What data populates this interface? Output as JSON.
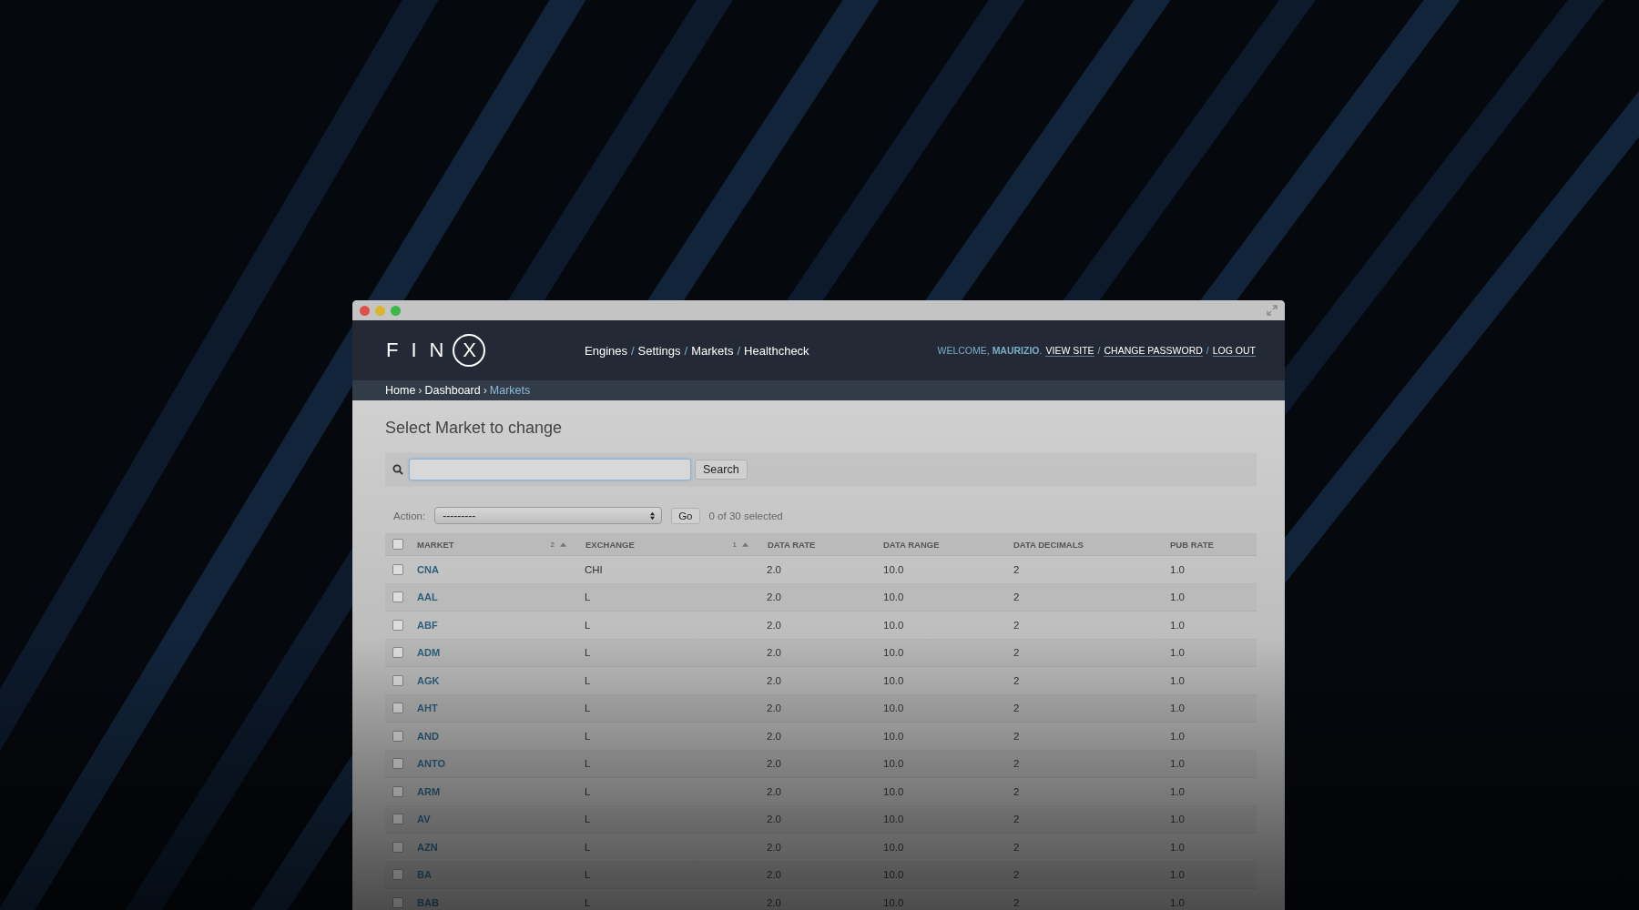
{
  "window": {
    "controls": [
      {
        "color": "#e0504a"
      },
      {
        "color": "#d9b530"
      },
      {
        "color": "#3cb84a"
      }
    ]
  },
  "logo": {
    "letters": [
      "F",
      "I",
      "N"
    ],
    "circled": "X"
  },
  "nav": {
    "links": [
      "Engines",
      "Settings",
      "Markets",
      "Healthcheck"
    ],
    "separator": "/"
  },
  "user_tools": {
    "welcome": "WELCOME,",
    "user": "MAURIZIO",
    "user_suffix": ".",
    "links": [
      "VIEW SITE",
      "CHANGE PASSWORD",
      "LOG OUT"
    ],
    "separator": "/"
  },
  "breadcrumbs": {
    "items": [
      {
        "label": "Home",
        "current": false
      },
      {
        "label": "Dashboard",
        "current": false
      },
      {
        "label": "Markets",
        "current": true
      }
    ],
    "separator": "›"
  },
  "heading": "Select Market to change",
  "search": {
    "button": "Search"
  },
  "actions": {
    "label": "Action:",
    "value": "---------",
    "go": "Go",
    "counter": "0 of 30 selected"
  },
  "table": {
    "columns": [
      {
        "label": "MARKET",
        "sort_priority": "2",
        "select_all_checked": false
      },
      {
        "label": "EXCHANGE",
        "sort_priority": "1"
      },
      {
        "label": "DATA RATE"
      },
      {
        "label": "DATA RANGE"
      },
      {
        "label": "DATA DECIMALS"
      },
      {
        "label": "PUB RATE"
      }
    ],
    "rows": [
      {
        "checked": false,
        "cells": [
          "CNA",
          "CHI",
          "2.0",
          "10.0",
          "2",
          "1.0"
        ]
      },
      {
        "checked": false,
        "cells": [
          "AAL",
          "L",
          "2.0",
          "10.0",
          "2",
          "1.0"
        ]
      },
      {
        "checked": false,
        "cells": [
          "ABF",
          "L",
          "2.0",
          "10.0",
          "2",
          "1.0"
        ]
      },
      {
        "checked": false,
        "cells": [
          "ADM",
          "L",
          "2.0",
          "10.0",
          "2",
          "1.0"
        ]
      },
      {
        "checked": false,
        "cells": [
          "AGK",
          "L",
          "2.0",
          "10.0",
          "2",
          "1.0"
        ]
      },
      {
        "checked": false,
        "cells": [
          "AHT",
          "L",
          "2.0",
          "10.0",
          "2",
          "1.0"
        ]
      },
      {
        "checked": false,
        "cells": [
          "AND",
          "L",
          "2.0",
          "10.0",
          "2",
          "1.0"
        ]
      },
      {
        "checked": false,
        "cells": [
          "ANTO",
          "L",
          "2.0",
          "10.0",
          "2",
          "1.0"
        ]
      },
      {
        "checked": false,
        "cells": [
          "ARM",
          "L",
          "2.0",
          "10.0",
          "2",
          "1.0"
        ]
      },
      {
        "checked": false,
        "cells": [
          "AV",
          "L",
          "2.0",
          "10.0",
          "2",
          "1.0"
        ]
      },
      {
        "checked": false,
        "cells": [
          "AZN",
          "L",
          "2.0",
          "10.0",
          "2",
          "1.0"
        ]
      },
      {
        "checked": false,
        "cells": [
          "BA",
          "L",
          "2.0",
          "10.0",
          "2",
          "1.0"
        ]
      },
      {
        "checked": false,
        "cells": [
          "BAB",
          "L",
          "2.0",
          "10.0",
          "2",
          "1.0"
        ]
      }
    ]
  }
}
